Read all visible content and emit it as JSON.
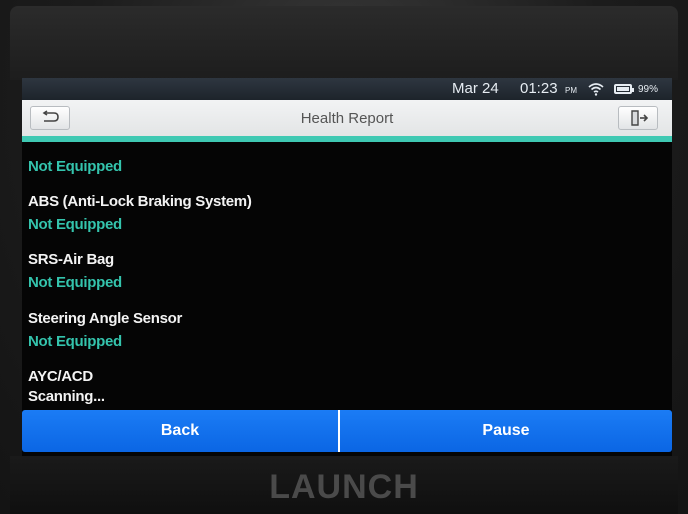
{
  "status": {
    "date": "Mar 24",
    "time": "01:23",
    "ampm": "PM",
    "battery": "99%"
  },
  "header": {
    "title": "Health Report"
  },
  "report": {
    "rows": [
      {
        "name": "",
        "status": "Not Equipped"
      },
      {
        "name": "ABS (Anti-Lock Braking System)",
        "status": "Not Equipped"
      },
      {
        "name": "SRS-Air Bag",
        "status": "Not Equipped"
      },
      {
        "name": "Steering Angle Sensor",
        "status": "Not Equipped"
      },
      {
        "name": "AYC/ACD",
        "status": "Scanning..."
      }
    ]
  },
  "footer": {
    "back_label": "Back",
    "pause_label": "Pause"
  },
  "device": {
    "brand": "LAUNCH"
  },
  "colors": {
    "accent": "#3fc9b3",
    "button": "#0b66e4",
    "status_text": "#34c4ad"
  },
  "icons": {
    "back": "back-arrow-icon",
    "exit": "exit-icon",
    "wifi": "wifi-icon",
    "battery": "battery-icon"
  }
}
